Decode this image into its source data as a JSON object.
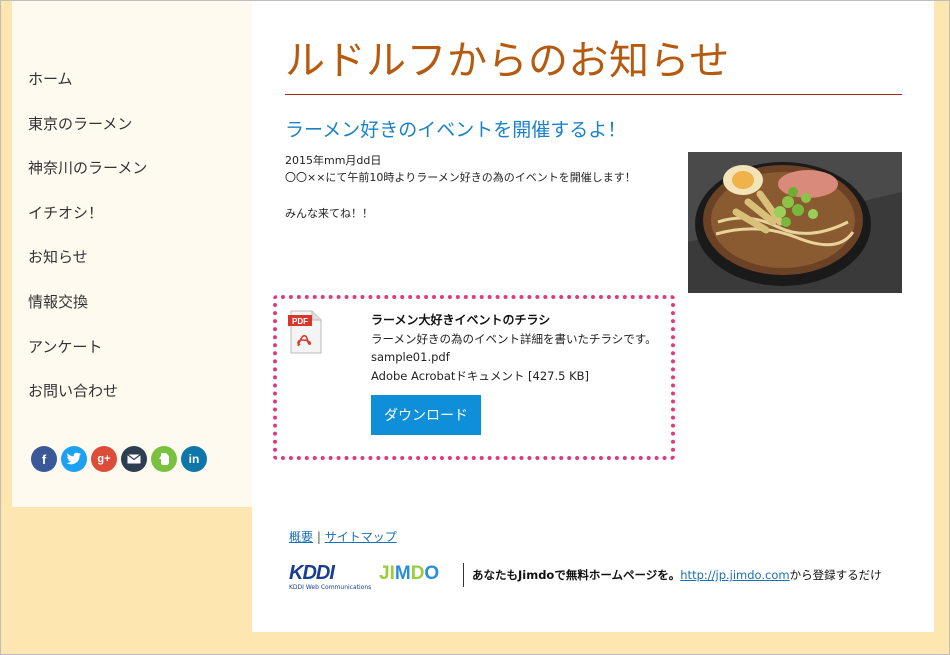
{
  "sidebar": {
    "items": [
      {
        "label": "ホーム"
      },
      {
        "label": "東京のラーメン"
      },
      {
        "label": "神奈川のラーメン"
      },
      {
        "label": "イチオシ！"
      },
      {
        "label": "お知らせ"
      },
      {
        "label": "情報交換"
      },
      {
        "label": "アンケート"
      },
      {
        "label": "お問い合わせ"
      }
    ],
    "social": [
      {
        "icon": "facebook-icon",
        "glyph": "f",
        "color": "#3b5998"
      },
      {
        "icon": "twitter-icon",
        "glyph": "t",
        "color": "#1da1f2"
      },
      {
        "icon": "google-plus-icon",
        "glyph": "g+",
        "color": "#dd4b39"
      },
      {
        "icon": "mail-icon",
        "glyph": "✉",
        "color": "#2c3e50"
      },
      {
        "icon": "evernote-icon",
        "glyph": "e",
        "color": "#7ac142"
      },
      {
        "icon": "linkedin-icon",
        "glyph": "in",
        "color": "#0e76a8"
      }
    ]
  },
  "main": {
    "title": "ルドルフからのお知らせ",
    "subtitle": "ラーメン好きのイベントを開催するよ！",
    "date": "2015年mm月dd日",
    "description": "〇〇××にて午前10時よりラーメン好きの為のイベントを開催します！",
    "closing": "みんな来てね！！"
  },
  "download": {
    "title": "ラーメン大好きイベントのチラシ",
    "description": "ラーメン好きの為のイベント詳細を書いたチラシです。",
    "filename": "sample01.pdf",
    "filetype": "Adobe Acrobatドキュメント [427.5 KB]",
    "button_label": "ダウンロード",
    "pdf_icon_label": "PDF"
  },
  "footer": {
    "link_overview": "概要",
    "separator": "|",
    "link_sitemap": "サイトマップ",
    "kddi_logo": "KDDI",
    "kddi_sub": "KDDI Web Communications",
    "jimdo_prefix": "あなたもJimdoで無料ホームページを。",
    "jimdo_url": "http://jp.jimdo.com",
    "jimdo_suffix": "から登録するだけ"
  },
  "colors": {
    "accent_title": "#b55a0e",
    "accent_subtitle": "#1a83c7",
    "download_border": "#e03a7f",
    "button": "#0f8fd8",
    "page_bg": "#fde6b0"
  }
}
